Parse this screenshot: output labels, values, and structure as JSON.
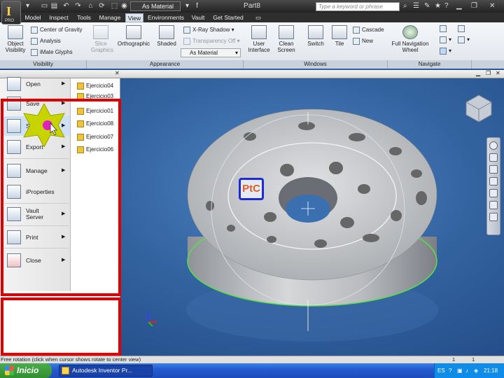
{
  "titlebar": {
    "app_logo": "I",
    "app_logo_sub": "PRO",
    "material_select": "As Material",
    "document_title": "Part8",
    "search_placeholder": "Type a keyword or phrase"
  },
  "tabs": [
    "Model",
    "Inspect",
    "Tools",
    "Manage",
    "View",
    "Environments",
    "Vault",
    "Get Started"
  ],
  "active_tab": "View",
  "ribbon": {
    "visibility": {
      "title": "Visibility",
      "object_visibility": "Object Visibility",
      "center_of_gravity": "Center of Gravity",
      "analysis": "Analysis",
      "imate_glyphs": "iMate Glyphs"
    },
    "appearance": {
      "title": "Appearance",
      "slice_graphics": "Slice Graphics",
      "orthographic": "Orthographic",
      "shaded": "Shaded",
      "xray_shadow": "X-Ray Shadow",
      "transparency_off": "Transparency Off",
      "material": "As Material"
    },
    "windows": {
      "title": "Windows",
      "user_interface": "User Interface",
      "clean_screen": "Clean Screen",
      "switch": "Switch",
      "tile": "Tile",
      "cascade": "Cascade",
      "new": "New"
    },
    "navigate": {
      "title": "Navigate",
      "full_navigation_wheel": "Full Navigation Wheel"
    }
  },
  "app_menu": {
    "commands": [
      {
        "label": "Open",
        "icon": "open-folder-icon",
        "has_submenu": true
      },
      {
        "label": "Save",
        "icon": "save-icon",
        "has_submenu": true
      },
      {
        "label": "Save As",
        "icon": "save-as-icon",
        "has_submenu": true
      },
      {
        "label": "Export",
        "icon": "export-icon",
        "has_submenu": true
      },
      {
        "label": "Manage",
        "icon": "manage-icon",
        "has_submenu": true
      },
      {
        "label": "iProperties",
        "icon": "iproperties-icon",
        "has_submenu": false
      },
      {
        "label": "Vault Server",
        "icon": "vault-server-icon",
        "has_submenu": true
      },
      {
        "label": "Print",
        "icon": "print-icon",
        "has_submenu": true
      },
      {
        "label": "Close",
        "icon": "close-doc-icon",
        "has_submenu": true
      }
    ],
    "recent_files": [
      "Ejercicio04",
      "Ejercicio03",
      "Ejercicio01",
      "Ejercicio08",
      "Ejercicio07",
      "Ejercicio06"
    ]
  },
  "viewport": {
    "overlay_logo": "PtC"
  },
  "status_bar": {
    "message": "Free rotation (click when cursor shows rotate to center view)",
    "count_a": "1",
    "count_b": "1"
  },
  "taskbar": {
    "start_label": "Inicio",
    "task_label": "Autodesk Inventor Pr...",
    "language": "ES",
    "clock": "21:18"
  },
  "colors": {
    "highlight_border": "#e10000",
    "viewport_bg": "#33639f",
    "taskbar_bg": "#245bd0",
    "start_button": "#2f8f2f",
    "cursor_star": "#c8d400"
  }
}
